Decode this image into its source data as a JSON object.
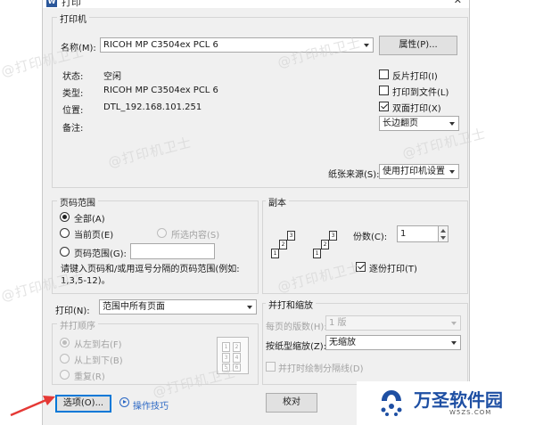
{
  "window": {
    "title": "打印",
    "close_glyph": "✕",
    "app_icon": "W"
  },
  "printer": {
    "group_title": "打印机",
    "name_label": "名称(M):",
    "name_value": "RICOH MP C3504ex PCL 6",
    "properties_button": "属性(P)...",
    "status_label": "状态:",
    "status_value": "空闲",
    "type_label": "类型:",
    "type_value": "RICOH MP C3504ex PCL 6",
    "location_label": "位置:",
    "location_value": "DTL_192.168.101.251",
    "comment_label": "备注:",
    "reverse_print": "反片打印(I)",
    "print_to_file": "打印到文件(L)",
    "duplex": "双面打印(X)",
    "duplex_mode": "长边翻页",
    "paper_source_label": "纸张来源(S):",
    "paper_source_value": "使用打印机设置"
  },
  "page_range": {
    "group_title": "页码范围",
    "all": "全部(A)",
    "current": "当前页(E)",
    "selection": "所选内容(S)",
    "pages": "页码范围(G):",
    "hint": "请键入页码和/或用逗号分隔的页码范围(例如: 1,3,5-12)。"
  },
  "copies": {
    "group_title": "副本",
    "count_label": "份数(C):",
    "count_value": "1",
    "collate": "逐份打印(T)",
    "page_digits": [
      "3",
      "2",
      "1"
    ]
  },
  "print_what": {
    "label": "打印(N):",
    "value": "范围中所有页面",
    "order_title": "并打顺序",
    "left_to_right": "从左到右(F)",
    "top_to_bottom": "从上到下(B)",
    "repeat": "重复(R)",
    "grid_digits": [
      "1",
      "2",
      "3",
      "4",
      "5",
      "6"
    ]
  },
  "zoom": {
    "group_title": "并打和缩放",
    "pages_per_sheet_label": "每页的版数(H):",
    "pages_per_sheet_value": "1 版",
    "scale_label": "按纸型缩放(Z):",
    "scale_value": "无缩放",
    "draw_borders": "并打时绘制分隔线(D)"
  },
  "footer": {
    "options_button": "选项(O)...",
    "tips_link": "操作技巧",
    "ok_button": "校对"
  },
  "watermark_text": "@打印机卫士",
  "logo": {
    "name": "万圣软件园",
    "domain": "W5ZS.COM"
  },
  "colors": {
    "accent": "#0078d7",
    "arrow": "#e53935",
    "logo": "#1e4fa3"
  }
}
